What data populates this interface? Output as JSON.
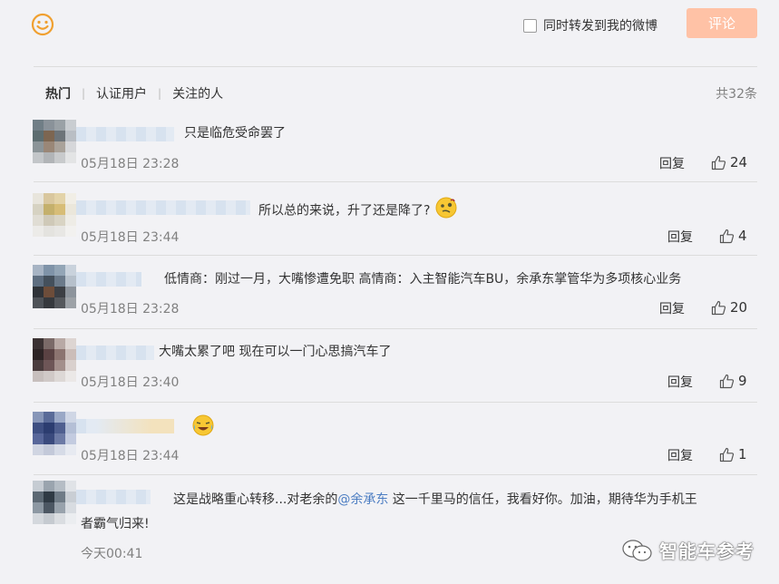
{
  "composer": {
    "forward_label": "同时转发到我的微博",
    "comment_button": "评论",
    "accent_color": "#ffc2a6",
    "emoji_icon": "smiley-icon"
  },
  "tabs": [
    {
      "label": "热门",
      "active": true
    },
    {
      "label": "认证用户",
      "active": false
    },
    {
      "label": "关注的人",
      "active": false
    }
  ],
  "total_label": "共32条",
  "reply_label": "回复",
  "comments": [
    {
      "text": "只是临危受命罢了",
      "time": "05月18日 23:28",
      "likes": "24"
    },
    {
      "text": "所以总的来说，升了还是降了?",
      "time": "05月18日 23:44",
      "likes": "4",
      "emoji": "thinking-emoji-icon"
    },
    {
      "text": "低情商：刚过一月，大嘴惨遭免职 高情商：入主智能汽车BU，余承东掌管华为多项核心业务",
      "time": "05月18日 23:28",
      "likes": "20"
    },
    {
      "text": "大嘴太累了吧 现在可以一门心思搞汽车了",
      "time": "05月18日 23:40",
      "likes": "9"
    },
    {
      "text": "",
      "time": "05月18日 23:44",
      "likes": "1",
      "emoji": "crying-laughing-emoji-icon"
    },
    {
      "text_before": "这是战略重心转移...对老余的",
      "mention": "@余承东",
      "text_after": " 这一千里马的信任，我看好你。加油，期待华为手机王",
      "text_line2": "者霸气归来!",
      "time": "今天00:41"
    }
  ],
  "watermark": "智能车参考"
}
